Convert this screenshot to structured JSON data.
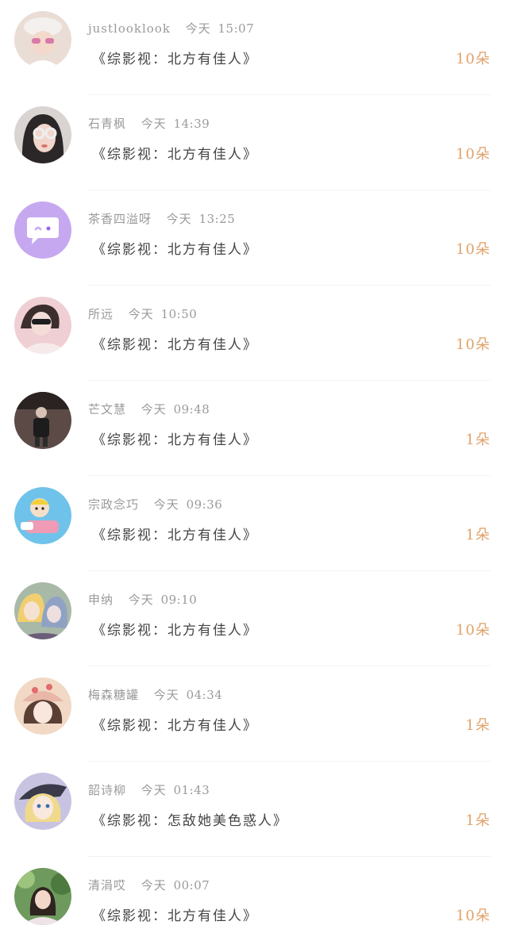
{
  "today_label": "今天",
  "gifts": [
    {
      "name": "justlooklook",
      "time": "15:07",
      "message": "《综影视：北方有佳人》",
      "amount": "10朵",
      "avatar_icon": "user-avatar-photo",
      "avatar_color": "#e9ddd6"
    },
    {
      "name": "石青枫",
      "time": "14:39",
      "message": "《综影视：北方有佳人》",
      "amount": "10朵",
      "avatar_icon": "user-avatar-photo",
      "avatar_color": "#d9d4d1"
    },
    {
      "name": "茶香四溢呀",
      "time": "13:25",
      "message": "《综影视：北方有佳人》",
      "amount": "10朵",
      "avatar_icon": "chat-bubble-avatar",
      "avatar_color": "#c6a8f0"
    },
    {
      "name": "所远",
      "time": "10:50",
      "message": "《综影视：北方有佳人》",
      "amount": "10朵",
      "avatar_icon": "user-avatar-photo",
      "avatar_color": "#efcfd4"
    },
    {
      "name": "芒文慧",
      "time": "09:48",
      "message": "《综影视：北方有佳人》",
      "amount": "1朵",
      "avatar_icon": "user-avatar-photo",
      "avatar_color": "#5b4a46"
    },
    {
      "name": "宗政念巧",
      "time": "09:36",
      "message": "《综影视：北方有佳人》",
      "amount": "1朵",
      "avatar_icon": "cartoon-avatar",
      "avatar_color": "#6fc3ea"
    },
    {
      "name": "申纳",
      "time": "09:10",
      "message": "《综影视：北方有佳人》",
      "amount": "10朵",
      "avatar_icon": "anime-avatar",
      "avatar_color": "#a9b9a8"
    },
    {
      "name": "梅森糖罐",
      "time": "04:34",
      "message": "《综影视：北方有佳人》",
      "amount": "1朵",
      "avatar_icon": "user-avatar-photo",
      "avatar_color": "#f1d9c6"
    },
    {
      "name": "韶诗柳",
      "time": "01:43",
      "message": "《综影视：怎敌她美色惑人》",
      "amount": "1朵",
      "avatar_icon": "anime-avatar",
      "avatar_color": "#c9c3e2"
    },
    {
      "name": "清涓哎",
      "time": "00:07",
      "message": "《综影视：北方有佳人》",
      "amount": "10朵",
      "avatar_icon": "user-avatar-photo",
      "avatar_color": "#6f9a5d"
    }
  ]
}
